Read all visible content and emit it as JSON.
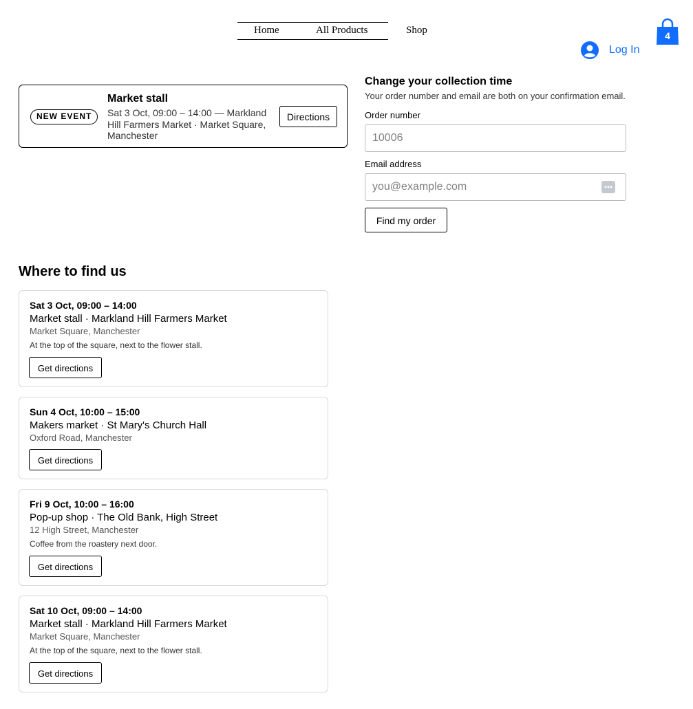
{
  "nav": {
    "items": [
      "Home",
      "All Products",
      "Shop"
    ]
  },
  "account": {
    "login_label": "Log In"
  },
  "cart": {
    "count": "4"
  },
  "event": {
    "badge": "NEW EVENT",
    "title": "Market stall",
    "description": "Sat 3 Oct, 09:00 – 14:00 — Markland Hill Farmers Market · Market Square, Manchester",
    "directions_label": "Directions"
  },
  "collection_form": {
    "heading": "Change your collection time",
    "subtext": "Your order number and email are both on your confirmation email.",
    "order_label": "Order number",
    "order_placeholder": "10006",
    "email_label": "Email address",
    "email_placeholder": "you@example.com",
    "submit_label": "Find my order"
  },
  "locations": {
    "heading": "Where to find us",
    "items": [
      {
        "when": "Sat 3 Oct, 09:00 – 14:00",
        "place": "Market stall · Markland Hill Farmers Market",
        "address": "Market Square, Manchester",
        "note": "At the top of the square, next to the flower stall.",
        "button": "Get directions"
      },
      {
        "when": "Sun 4 Oct, 10:00 – 15:00",
        "place": "Makers market · St Mary's Church Hall",
        "address": "Oxford Road, Manchester",
        "note": "",
        "button": "Get directions"
      },
      {
        "when": "Fri 9 Oct, 10:00 – 16:00",
        "place": "Pop-up shop · The Old Bank, High Street",
        "address": "12 High Street, Manchester",
        "note": "Coffee from the roastery next door.",
        "button": "Get directions"
      },
      {
        "when": "Sat 10 Oct, 09:00 – 14:00",
        "place": "Market stall · Markland Hill Farmers Market",
        "address": "Market Square, Manchester",
        "note": "At the top of the square, next to the flower stall.",
        "button": "Get directions"
      }
    ]
  },
  "colors": {
    "accent": "#116dff",
    "cart_blue": "#116dff"
  }
}
